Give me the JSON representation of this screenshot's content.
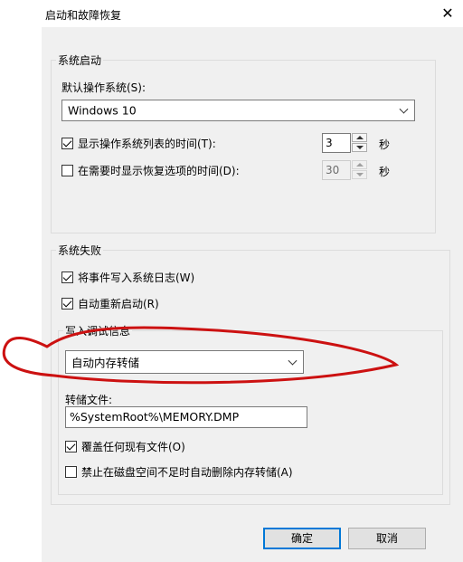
{
  "window": {
    "title": "启动和故障恢复",
    "close_glyph": "✕"
  },
  "system_startup": {
    "legend": "系统启动",
    "default_os_label": "默认操作系统(S):",
    "default_os_value": "Windows 10",
    "show_os_list": {
      "label": "显示操作系统列表的时间(T):",
      "checked": true,
      "value": "3",
      "unit": "秒"
    },
    "show_recovery": {
      "label": "在需要时显示恢复选项的时间(D):",
      "checked": false,
      "value": "30",
      "unit": "秒"
    }
  },
  "system_failure": {
    "legend": "系统失败",
    "write_event": {
      "label": "将事件写入系统日志(W)",
      "checked": true
    },
    "auto_restart": {
      "label": "自动重新启动(R)",
      "checked": true
    },
    "debug_info": {
      "legend": "写入调试信息",
      "type_value": "自动内存转储",
      "dump_file_label": "转储文件:",
      "dump_file_value": "%SystemRoot%\\MEMORY.DMP",
      "overwrite": {
        "label": "覆盖任何现有文件(O)",
        "checked": true
      },
      "disable_auto_delete": {
        "label": "禁止在磁盘空间不足时自动删除内存转储(A)",
        "checked": false
      }
    }
  },
  "buttons": {
    "ok": "确定",
    "cancel": "取消"
  },
  "colors": {
    "annotation": "#cc1111",
    "default_button_border": "#0078d7"
  }
}
